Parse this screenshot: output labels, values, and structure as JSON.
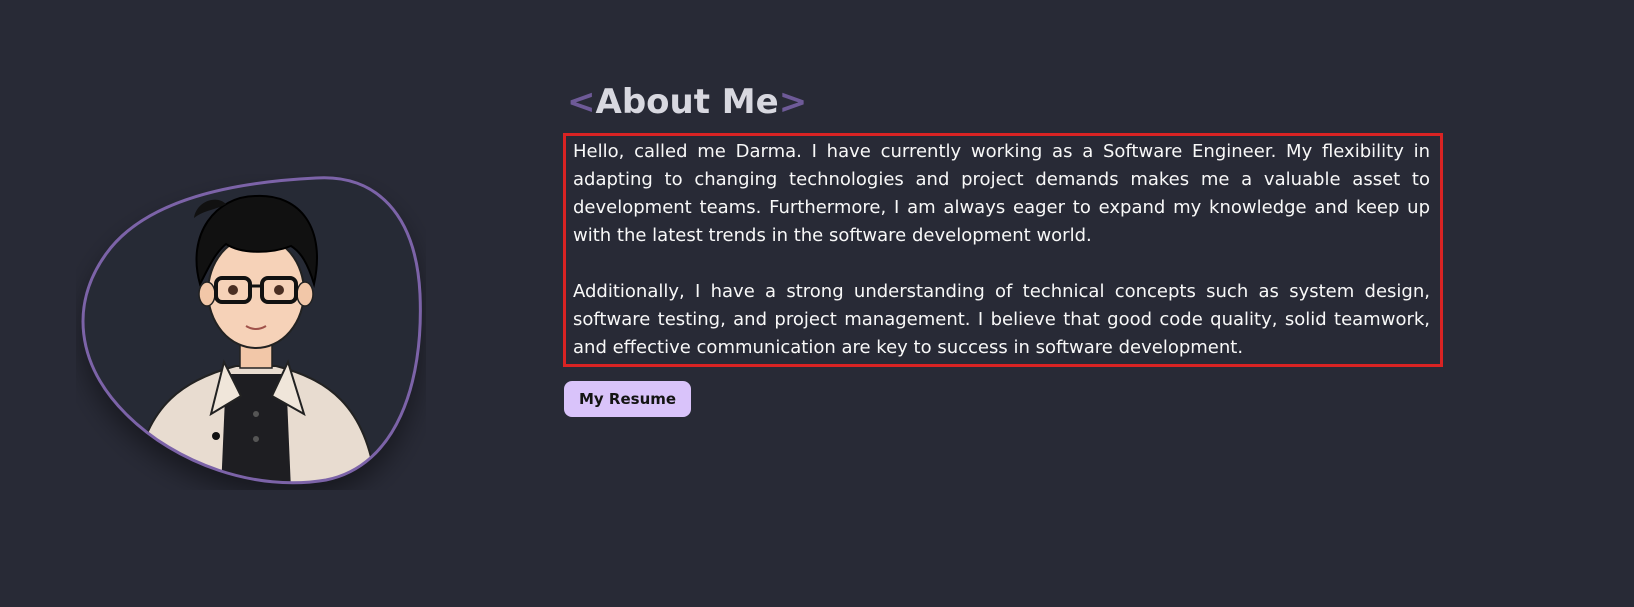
{
  "about": {
    "bracket_open": "<",
    "title": "About Me",
    "bracket_close": ">",
    "paragraphs": [
      "Hello, called me Darma. I have currently working as a Software Engineer. My flexibility in adapting to changing technologies and project demands makes me a valuable asset to development teams. Furthermore, I am always eager to expand my knowledge and keep up with the latest trends in the software development world.",
      "Additionally, I have a strong understanding of technical concepts such as system design, software testing, and project management. I believe that good code quality, solid teamwork, and effective communication are key to success in software development."
    ],
    "resume_button": "My Resume"
  },
  "colors": {
    "background": "#282a36",
    "accent": "#7c63a8",
    "highlight_border": "#d92323",
    "button_bg": "#d9c3fa"
  },
  "avatar": {
    "icon": "avatar-illustration"
  }
}
